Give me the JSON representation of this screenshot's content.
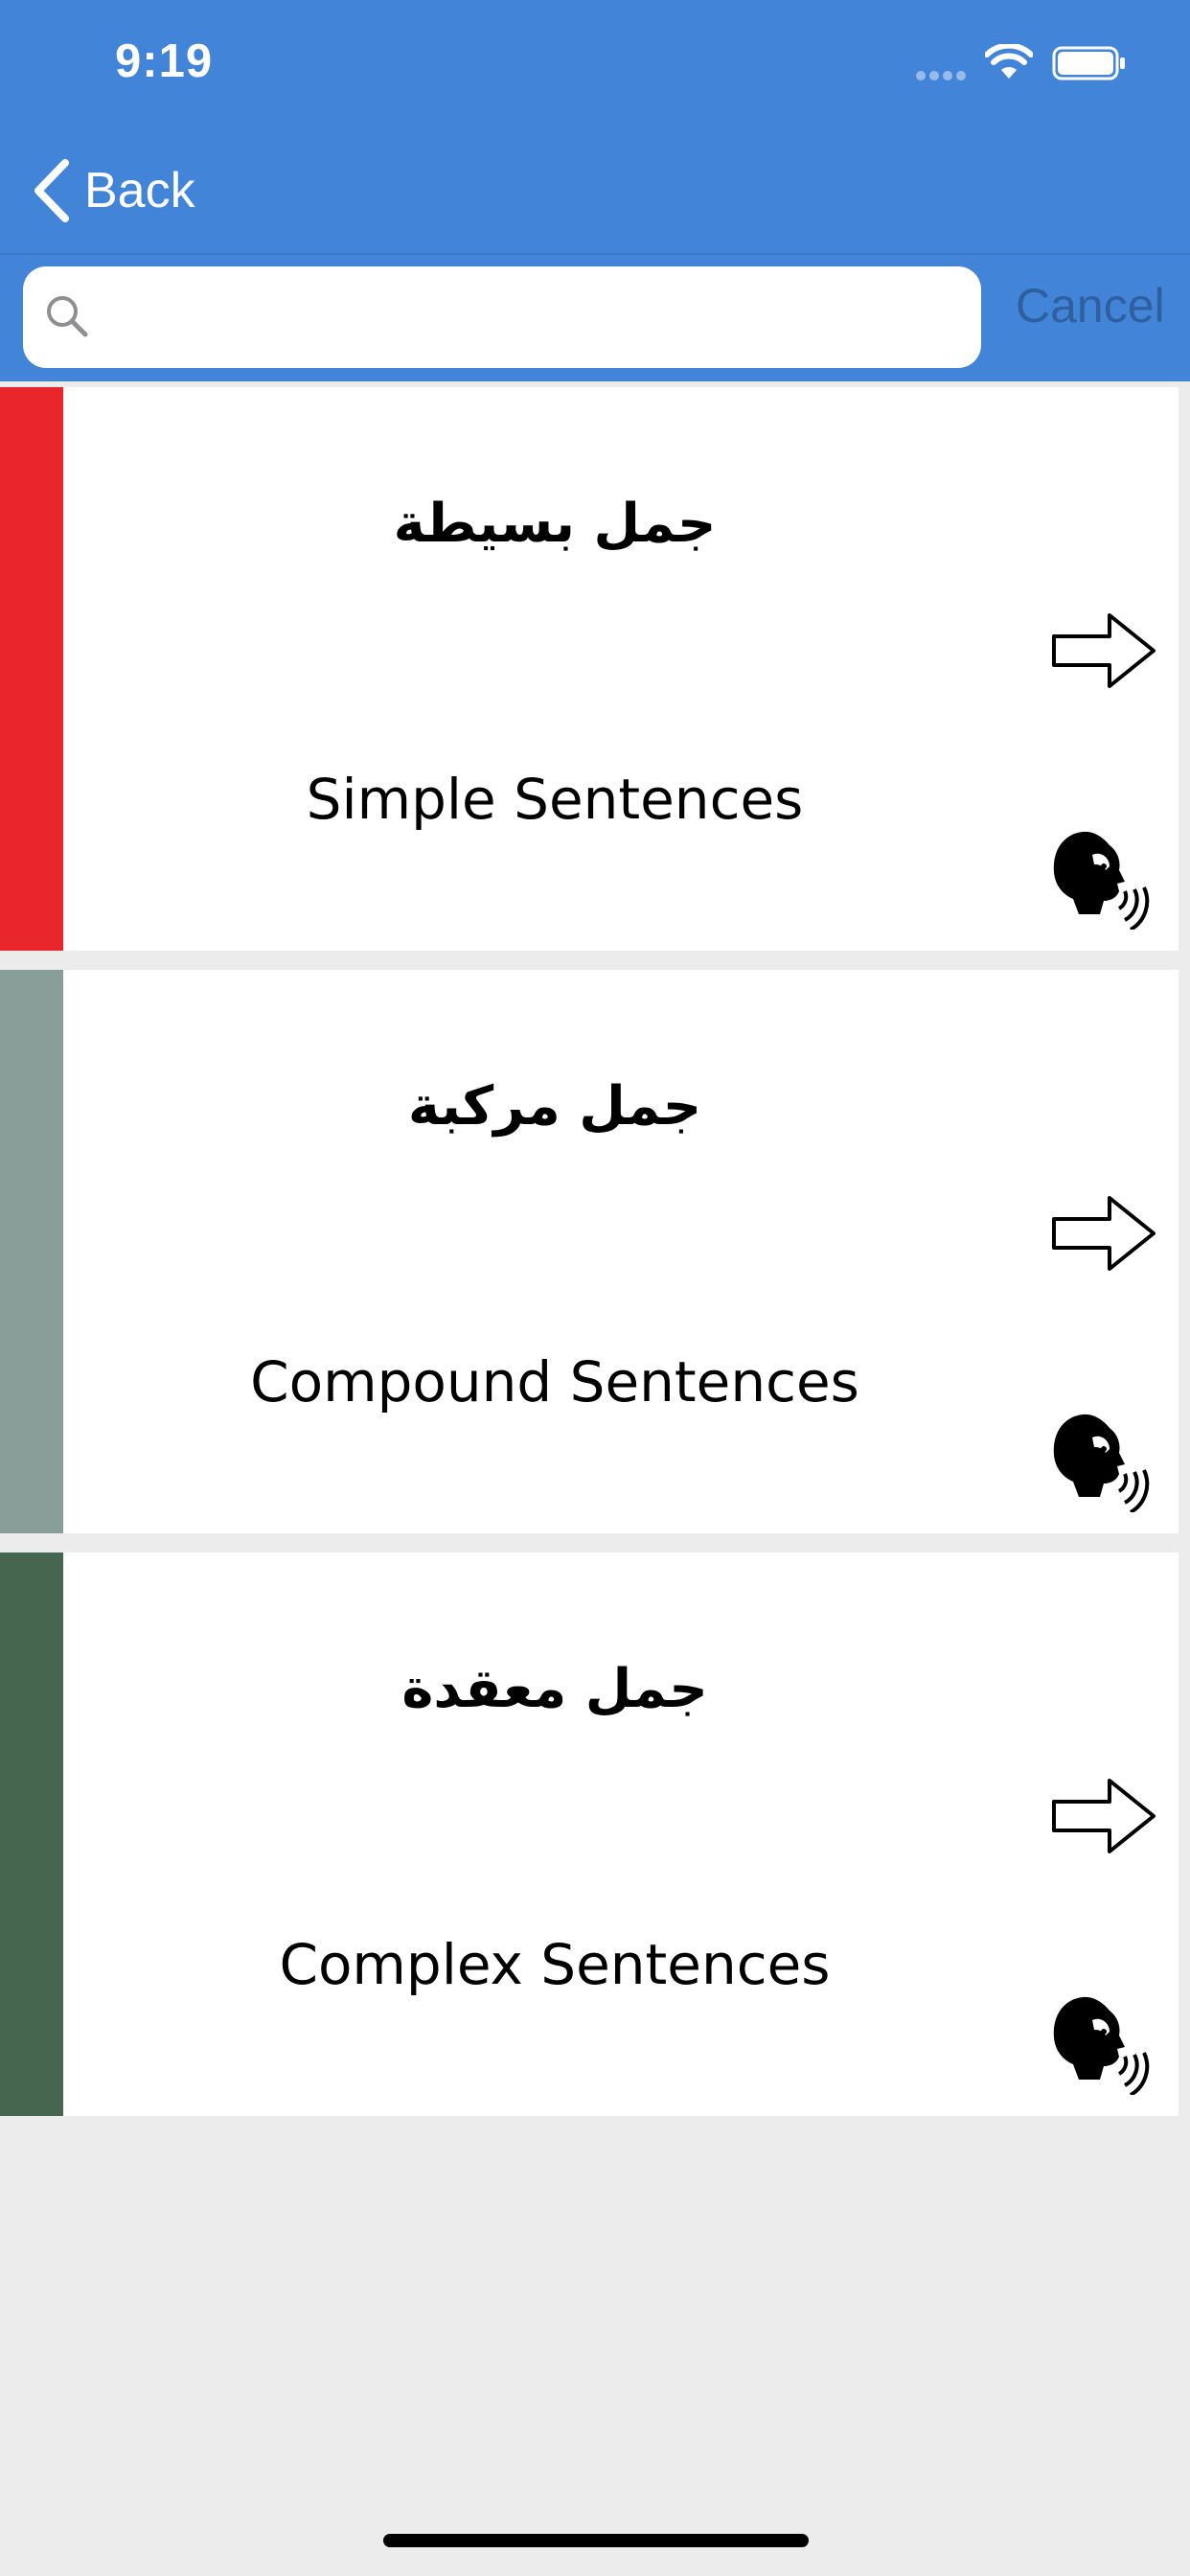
{
  "status_bar": {
    "time": "9:19"
  },
  "nav": {
    "back_label": "Back"
  },
  "search": {
    "placeholder": "",
    "value": "",
    "cancel_label": "Cancel"
  },
  "colors": {
    "header_blue": "#4285d8",
    "background": "#ececec"
  },
  "items": [
    {
      "arabic": "جمل بسيطة",
      "english": "Simple Sentences",
      "color": "#e8262c"
    },
    {
      "arabic": "جمل مركبة",
      "english": "Compound Sentences",
      "color": "#8a9e99"
    },
    {
      "arabic": "جمل معقدة",
      "english": "Complex Sentences",
      "color": "#476650"
    }
  ]
}
